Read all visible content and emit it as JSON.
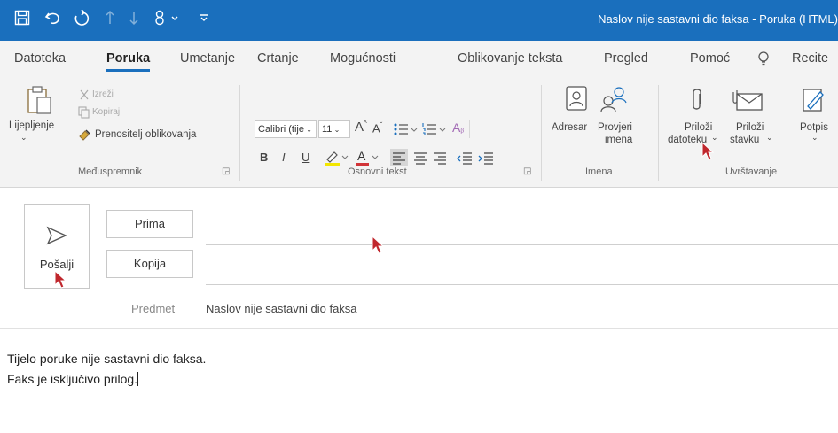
{
  "window": {
    "title": "Naslov nije sastavni dio faksa  -  Poruka (HTML)",
    "quick_access": [
      "save-icon",
      "undo-icon",
      "redo-icon",
      "up-arrow-icon",
      "down-arrow-icon",
      "attachment-dropdown-icon",
      "customize-icon"
    ]
  },
  "tabs": [
    {
      "label": "Datoteka"
    },
    {
      "label": "Poruka",
      "active": true
    },
    {
      "label": "Umetanje"
    },
    {
      "label": "Crtanje"
    },
    {
      "label": "Mogućnosti"
    },
    {
      "label": "Oblikovanje teksta"
    },
    {
      "label": "Pregled"
    },
    {
      "label": "Pomoć"
    },
    {
      "label": "Recite"
    }
  ],
  "ribbon": {
    "clipboard": {
      "paste_label": "Lijepljenje",
      "cut_label": "Izreži",
      "copy_label": "Kopiraj",
      "format_painter_label": "Prenositelj oblikovanja",
      "group_label": "Međuspremnik"
    },
    "basic_text": {
      "font_name": "Calibri (tije",
      "font_size": "11",
      "bold": "B",
      "italic": "I",
      "underline": "U",
      "group_label": "Osnovni tekst"
    },
    "names": {
      "address_book_label": "Adresar",
      "check_names_line1": "Provjeri",
      "check_names_line2": "imena",
      "group_label": "Imena"
    },
    "include": {
      "attach_file_line1": "Priloži",
      "attach_file_line2": "datoteku",
      "attach_item_line1": "Priloži",
      "attach_item_line2": "stavku",
      "signature_label": "Potpis",
      "group_label": "Uvrštavanje"
    }
  },
  "compose": {
    "send_label": "Pošalji",
    "to_label": "Prima",
    "to_value": "",
    "cc_label": "Kopija",
    "cc_value": "",
    "subject_label": "Predmet",
    "subject_value": "Naslov nije sastavni dio faksa",
    "body_lines": [
      "Tijelo poruke nije sastavni dio faksa.",
      "Faks je isključivo prilog."
    ]
  },
  "colors": {
    "title_bar": "#1a6fbd",
    "ribbon_bg": "#f3f3f3",
    "pointer": "#c0272d",
    "highlight_yellow": "#f2e600",
    "font_color_red": "#d13438"
  }
}
